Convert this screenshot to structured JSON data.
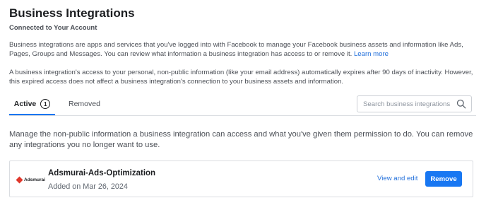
{
  "header": {
    "title": "Business Integrations",
    "subtitle": "Connected to Your Account"
  },
  "description": {
    "paragraph1": "Business integrations are apps and services that you've logged into with Facebook to manage your Facebook business assets and information like Ads, Pages, Groups and Messages. You can review what information a business integration has access to or remove it.",
    "learn_more": "Learn more",
    "paragraph2": "A business integration's access to your personal, non-public information (like your email address) automatically expires after 90 days of inactivity. However, this expired access does not affect a business integration's connection to your business assets and information."
  },
  "tabs": [
    {
      "label": "Active",
      "count": "1",
      "active": true
    },
    {
      "label": "Removed",
      "active": false
    }
  ],
  "search": {
    "placeholder": "Search business integrations",
    "value": "",
    "icon": "search-icon"
  },
  "manage_text": "Manage the non-public information a business integration can access and what you've given them permission to do. You can remove any integrations you no longer want to use.",
  "integrations": [
    {
      "logo_text": "Adsmurai",
      "name": "Adsmurai-Ads-Optimization",
      "added": "Added on Mar 26, 2024",
      "view_edit_label": "View and edit",
      "remove_label": "Remove"
    }
  ],
  "colors": {
    "accent": "#1877f2",
    "link": "#216fdb",
    "logo_mark": "#e0382c",
    "text_primary": "#1c1e21",
    "text_secondary": "#4b4f56",
    "border": "#dadde1"
  }
}
